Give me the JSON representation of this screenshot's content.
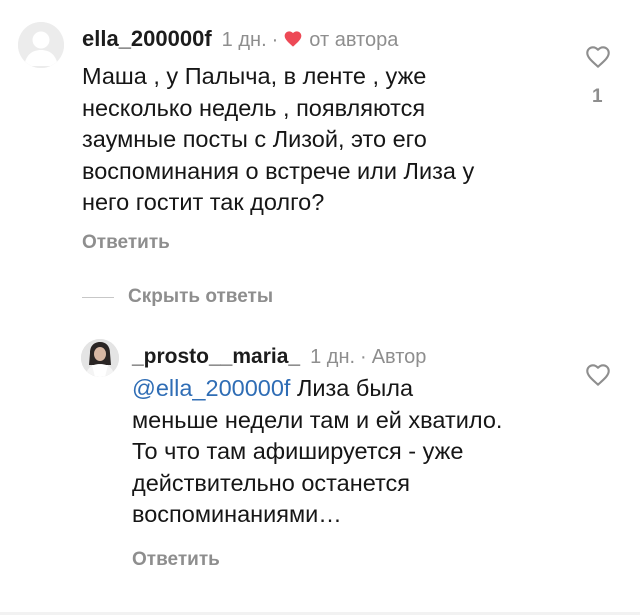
{
  "comment": {
    "username": "ella_200000f",
    "time": "1 дн.",
    "separator": "·",
    "author_like_label": "от автора",
    "text": "Маша , у Палыча, в ленте , уже\nнесколько недель , появляются\nзаумные посты с Лизой, это его\nвоспоминания о встрече или Лиза у\nнего гостит так долго?",
    "reply_label": "Ответить",
    "like_count": "1",
    "avatar_icon": "default-avatar-icon",
    "like_icon": "heart-outline-icon",
    "author_like_icon": "heart-filled-icon",
    "author_like_color": "#ed4956"
  },
  "thread": {
    "hide_replies_label": "Скрыть ответы"
  },
  "reply": {
    "username": "_prosto__maria_",
    "time": "1 дн.",
    "separator": "·",
    "author_label": "Автор",
    "mention": "@ella_200000f",
    "text": " Лиза была\nменьше недели там и ей хватило.\nТо что там афишируется - уже\nдействительно останется\nвоспоминаниями…",
    "reply_label": "Ответить",
    "avatar_icon": "profile-photo-avatar",
    "like_icon": "heart-outline-icon"
  },
  "colors": {
    "text": "#161616",
    "muted": "#8e8e8e",
    "mention": "#2f6db5",
    "heart_red": "#ed4956"
  }
}
